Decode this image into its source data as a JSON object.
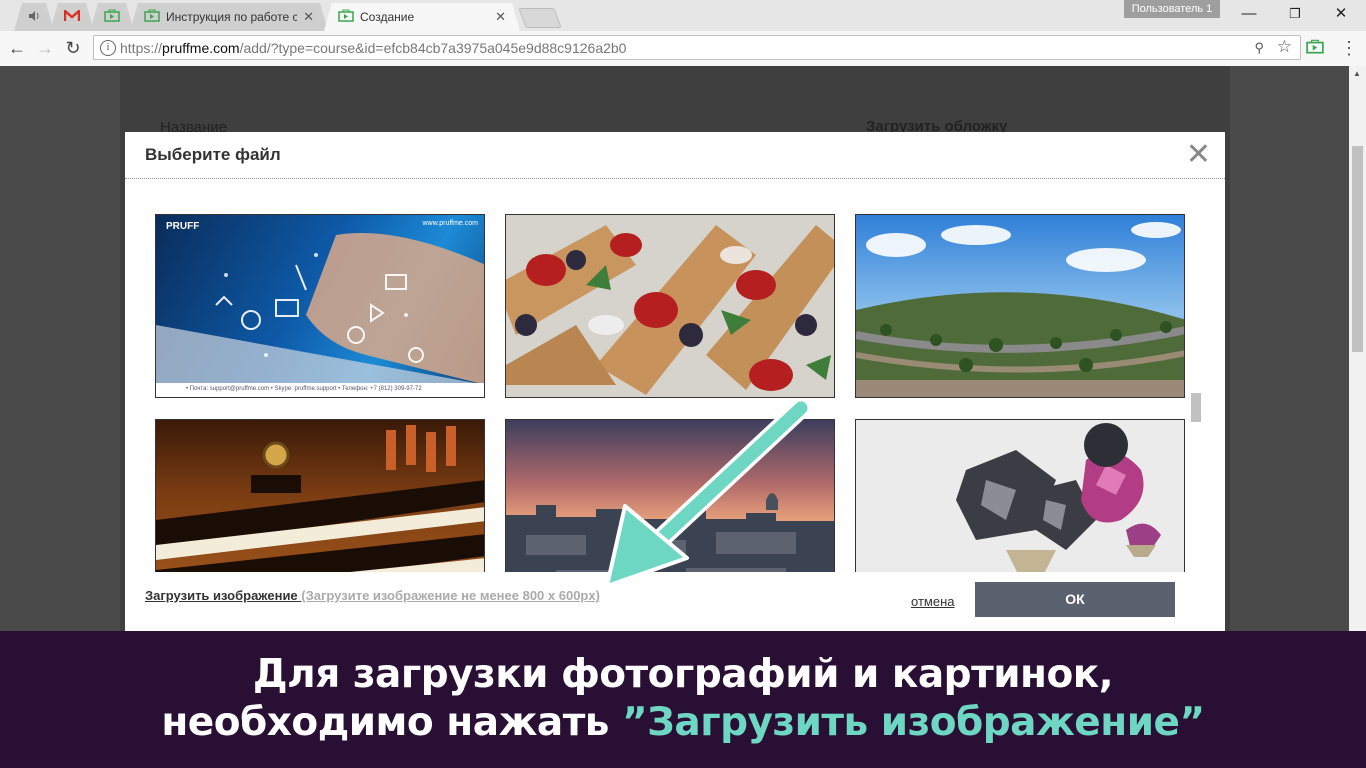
{
  "browser": {
    "tabs": [
      {
        "label": "",
        "icon": "speaker-icon"
      },
      {
        "label": "",
        "icon": "gmail-icon"
      },
      {
        "label": "",
        "icon": "pruffme-icon"
      },
      {
        "label": "Инструкция по работе с",
        "icon": "pruffme-icon"
      },
      {
        "label": "Создание",
        "icon": "pruffme-icon"
      }
    ],
    "profile": "Пользователь 1",
    "url_prefix": "https://",
    "url_host": "pruffme.com",
    "url_path": "/add/?type=course&id=efcb84cb7a3975a045e9d88c9126a2b0"
  },
  "page": {
    "name_label": "Название",
    "cover_label": "Загрузить обложку"
  },
  "modal": {
    "title": "Выберите файл",
    "images": [
      {
        "alt": "pruffme promo",
        "banner": "PRUFF",
        "site": "www.pruffme.com",
        "contacts": "• Почта: support@pruffme.com   • Skype: pruffme.support   • Телефон: +7 (812) 309-97-72"
      },
      {
        "alt": "strawberry waffle cones"
      },
      {
        "alt": "seaside promenade panorama"
      },
      {
        "alt": "pipe organ keyboards"
      },
      {
        "alt": "city rooftops at sunset"
      },
      {
        "alt": "abstract crystal shapes"
      }
    ],
    "upload_label": "Загрузить изображение",
    "upload_hint": "(Загрузите изображение не менее 800 х 600px)",
    "cancel_label": "отмена",
    "ok_label": "ОК"
  },
  "caption": {
    "line1": "Для загрузки фотографий и картинок,",
    "line2_prefix": "необходимо нажать ",
    "line2_highlight": "”Загрузить изображение”"
  },
  "colors": {
    "accent": "#6ed7c3",
    "caption_bg": "#2a0f35",
    "ok_button": "#5a6270"
  }
}
